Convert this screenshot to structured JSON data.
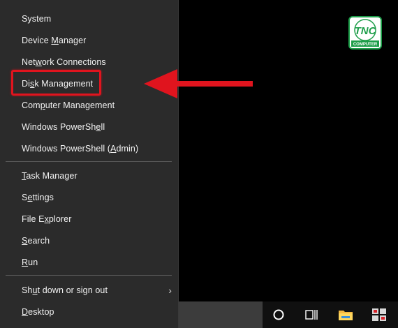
{
  "menu": {
    "group1": [
      {
        "label": "System",
        "underline_index": -1
      },
      {
        "label": "Device Manager",
        "underline_index": 7
      },
      {
        "label": "Network Connections",
        "underline_index": 3
      },
      {
        "label": "Disk Management",
        "underline_index": 2
      },
      {
        "label": "Computer Management",
        "underline_index": 3
      },
      {
        "label": "Windows PowerShell",
        "underline_index": 15
      },
      {
        "label": "Windows PowerShell (Admin)",
        "underline_index": 20
      }
    ],
    "group2": [
      {
        "label": "Task Manager",
        "underline_index": 0
      },
      {
        "label": "Settings",
        "underline_index": 1
      },
      {
        "label": "File Explorer",
        "underline_index": 6
      },
      {
        "label": "Search",
        "underline_index": 0
      },
      {
        "label": "Run",
        "underline_index": 0
      }
    ],
    "group3": [
      {
        "label": "Shut down or sign out",
        "underline_index": 2,
        "has_submenu": true
      },
      {
        "label": "Desktop",
        "underline_index": 0
      }
    ],
    "highlighted_item": "Disk Management"
  },
  "logo": {
    "text": "TNC",
    "subtext": "COMPUTER",
    "color": "#1e9e4a"
  },
  "annotation": {
    "arrow_color": "#e0141e",
    "box_color": "#e0141e"
  },
  "taskbar": {
    "icons": [
      "cortana-circle-icon",
      "task-view-icon",
      "file-explorer-folder-icon",
      "app-tiles-icon"
    ]
  }
}
